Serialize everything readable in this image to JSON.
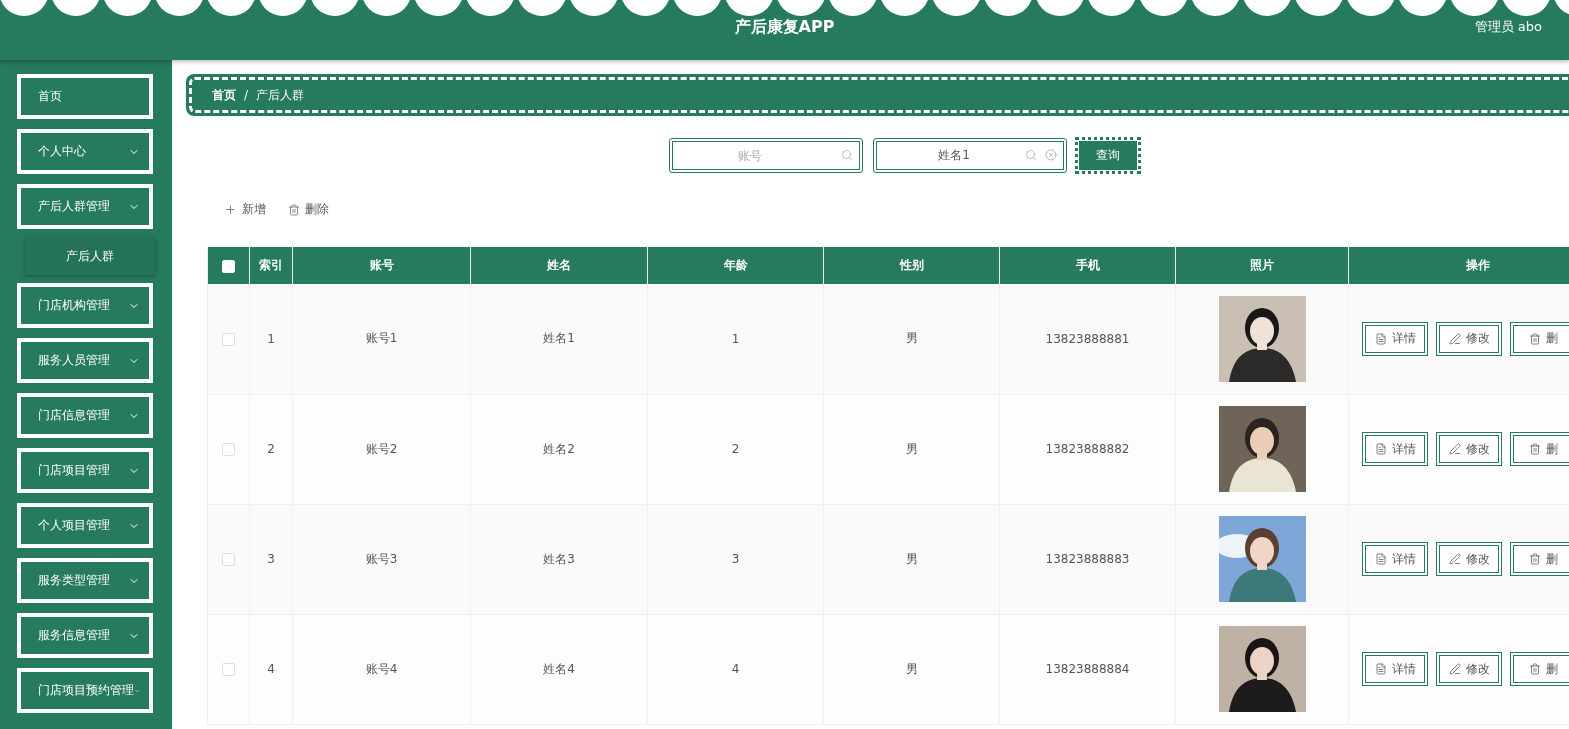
{
  "header": {
    "title": "产后康复APP",
    "user": "管理员 abo"
  },
  "sidebar": {
    "items": [
      {
        "label": "首页",
        "kind": "link"
      },
      {
        "label": "个人中心",
        "kind": "group"
      },
      {
        "label": "产后人群管理",
        "kind": "group",
        "children": [
          {
            "label": "产后人群",
            "selected": true
          }
        ]
      },
      {
        "label": "门店机构管理",
        "kind": "group"
      },
      {
        "label": "服务人员管理",
        "kind": "group"
      },
      {
        "label": "门店信息管理",
        "kind": "group"
      },
      {
        "label": "门店项目管理",
        "kind": "group"
      },
      {
        "label": "个人项目管理",
        "kind": "group"
      },
      {
        "label": "服务类型管理",
        "kind": "group"
      },
      {
        "label": "服务信息管理",
        "kind": "group"
      },
      {
        "label": "门店项目预约管理",
        "kind": "group"
      }
    ]
  },
  "breadcrumb": {
    "items": [
      "首页",
      "产后人群"
    ],
    "separator": "/"
  },
  "search": {
    "fields": [
      {
        "placeholder": "账号",
        "clearable": false
      },
      {
        "value": "姓名1",
        "clearable": true
      }
    ],
    "button": "查询"
  },
  "toolbar": [
    {
      "label": "新增",
      "kind": "add"
    },
    {
      "label": "删除",
      "kind": "delete"
    }
  ],
  "table": {
    "all_checked": false,
    "columns": [
      "索引",
      "账号",
      "姓名",
      "年龄",
      "性别",
      "手机",
      "照片",
      "操作"
    ],
    "rows": [
      {
        "checked": false,
        "cells": [
          "1",
          "账号1",
          "姓名1",
          "1",
          "男",
          "13823888881"
        ],
        "photo": {
          "kind": "picture"
        },
        "actions": [
          {
            "label": "详情",
            "kind": "detail"
          },
          {
            "label": "修改",
            "kind": "edit"
          },
          {
            "label": "删",
            "kind": "delete"
          }
        ]
      },
      {
        "checked": false,
        "cells": [
          "2",
          "账号2",
          "姓名2",
          "2",
          "男",
          "13823888882"
        ],
        "photo": {
          "kind": "picture"
        },
        "actions": [
          {
            "label": "详情",
            "kind": "detail"
          },
          {
            "label": "修改",
            "kind": "edit"
          },
          {
            "label": "删",
            "kind": "delete"
          }
        ]
      },
      {
        "checked": false,
        "cells": [
          "3",
          "账号3",
          "姓名3",
          "3",
          "男",
          "13823888883"
        ],
        "photo": {
          "kind": "picture"
        },
        "actions": [
          {
            "label": "详情",
            "kind": "detail"
          },
          {
            "label": "修改",
            "kind": "edit"
          },
          {
            "label": "删",
            "kind": "delete"
          }
        ]
      },
      {
        "checked": false,
        "cells": [
          "4",
          "账号4",
          "姓名4",
          "4",
          "男",
          "13823888884"
        ],
        "photo": {
          "kind": "picture"
        },
        "actions": [
          {
            "label": "详情",
            "kind": "detail"
          },
          {
            "label": "修改",
            "kind": "edit"
          },
          {
            "label": "删",
            "kind": "delete"
          }
        ]
      }
    ]
  }
}
